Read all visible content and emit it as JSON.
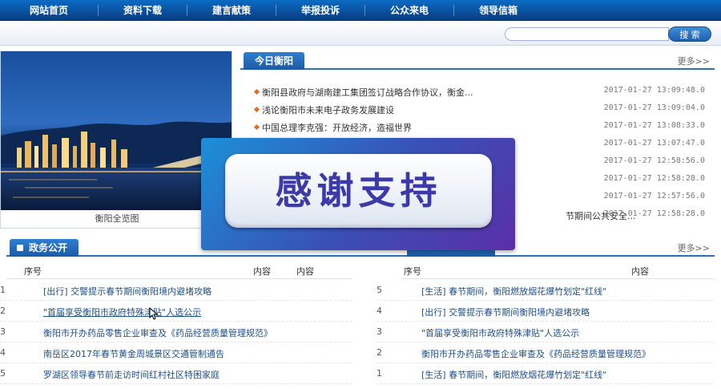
{
  "nav": {
    "items": [
      "网站首页",
      "资料下载",
      "建言献策",
      "举报投诉",
      "公众来电",
      "领导信箱"
    ]
  },
  "search": {
    "placeholder": "",
    "button_label": "搜 索"
  },
  "hero": {
    "caption": "衡阳全览图"
  },
  "today": {
    "tab_label": "今日衡阳",
    "more_label": "更多>>",
    "items": [
      {
        "title": "衡阳县政府与湖南建工集团签订战略合作协议，衡金...",
        "date": "2017-01-27 13:09:48.0"
      },
      {
        "title": "浅论衡阳市未来电子政务发展建设",
        "date": "2017-01-27 13:09:04.0"
      },
      {
        "title": "中国总理李克强：开放经济，造福世界",
        "date": "2017-01-27 13:08:33.0"
      },
      {
        "title": "",
        "date": "2017-01-27 13:07:47.0"
      },
      {
        "title": "",
        "date": "2017-01-27 12:58:56.0"
      },
      {
        "title": "",
        "date": "2017-01-27 12:58:28.0"
      },
      {
        "title": "",
        "date": "2017-01-27 12:57:56.0"
      },
      {
        "title": "节期间公共安全...",
        "date": "2017-01-27 12:58:28.0"
      }
    ]
  },
  "gov": {
    "tab_label": "政务公开",
    "more_label": "更多>>",
    "left": {
      "col_seq": "序号",
      "col_content_1": "内容",
      "col_content_2": "内容",
      "rows": [
        {
          "num": "1",
          "text": "[出行] 交警提示春节期间衡阳境内避堵攻略"
        },
        {
          "num": "2",
          "text": "\"首届享受衡阳市政府特殊津贴\"人选公示"
        },
        {
          "num": "3",
          "text": "衡阳市开办药品零售企业审查及《药品经营质量管理规范》"
        },
        {
          "num": "4",
          "text": "南岳区2017年春节黄金周城景区交通管制通告"
        },
        {
          "num": "5",
          "text": "罗湖区领导春节前走访时间红村社区特困家庭"
        }
      ]
    },
    "right": {
      "col_seq": "序号",
      "col_content": "内容",
      "rows": [
        {
          "num": "5",
          "text": "[生活] 春节期间，衡阳燃放烟花爆竹划定\"红线\""
        },
        {
          "num": "4",
          "text": "[出行] 交警提示春节期间衡阳境内避堵攻略"
        },
        {
          "num": "3",
          "text": "\"首届享受衡阳市政府特殊津贴\"人选公示"
        },
        {
          "num": "2",
          "text": "衡阳市开办药品零售企业审查及《药品经营质量管理规范》"
        },
        {
          "num": "1",
          "text": "[生活] 春节期间，衡阳燃放烟花爆竹划定\"红线\""
        }
      ]
    }
  },
  "overlay": {
    "text": "感谢支持"
  }
}
